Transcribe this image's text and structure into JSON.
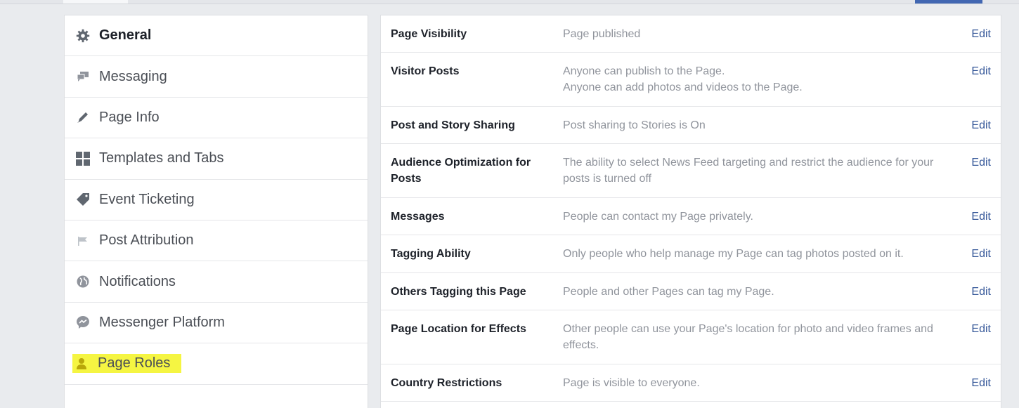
{
  "sidebar": {
    "items": [
      {
        "label": "General",
        "icon": "gear-icon",
        "active": true
      },
      {
        "label": "Messaging",
        "icon": "messaging-icon"
      },
      {
        "label": "Page Info",
        "icon": "pencil-icon"
      },
      {
        "label": "Templates and Tabs",
        "icon": "grid-icon"
      },
      {
        "label": "Event Ticketing",
        "icon": "ticket-icon"
      },
      {
        "label": "Post Attribution",
        "icon": "flag-icon"
      },
      {
        "label": "Notifications",
        "icon": "globe-icon"
      },
      {
        "label": "Messenger Platform",
        "icon": "messenger-icon"
      },
      {
        "label": "Page Roles",
        "icon": "person-icon",
        "highlighted": true
      }
    ]
  },
  "settings": {
    "edit_label": "Edit",
    "rows": [
      {
        "label": "Page Visibility",
        "desc": [
          "Page published"
        ]
      },
      {
        "label": "Visitor Posts",
        "desc": [
          "Anyone can publish to the Page.",
          "Anyone can add photos and videos to the Page."
        ]
      },
      {
        "label": "Post and Story Sharing",
        "desc": [
          "Post sharing to Stories is On"
        ]
      },
      {
        "label": "Audience Optimization for Posts",
        "desc": [
          "The ability to select News Feed targeting and restrict the audience for your posts is turned off"
        ]
      },
      {
        "label": "Messages",
        "desc": [
          "People can contact my Page privately."
        ]
      },
      {
        "label": "Tagging Ability",
        "desc": [
          "Only people who help manage my Page can tag photos posted on it."
        ]
      },
      {
        "label": "Others Tagging this Page",
        "desc": [
          "People and other Pages can tag my Page."
        ]
      },
      {
        "label": "Page Location for Effects",
        "desc": [
          "Other people can use your Page's location for photo and video frames and effects."
        ]
      },
      {
        "label": "Country Restrictions",
        "desc": [
          "Page is visible to everyone."
        ]
      }
    ]
  },
  "colors": {
    "link": "#365899",
    "highlight": "#f5f542",
    "background": "#e9ebee"
  }
}
